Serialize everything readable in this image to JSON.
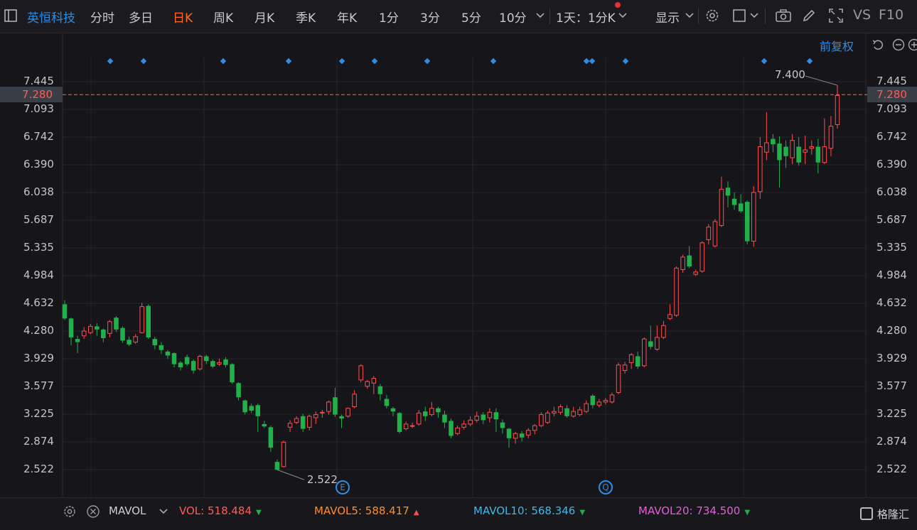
{
  "toolbar": {
    "stock_name": "英恒科技",
    "periods": [
      "分时",
      "多日",
      "日K",
      "周K",
      "月K",
      "季K",
      "年K",
      "1分",
      "3分",
      "5分",
      "10分"
    ],
    "active_period": "日K",
    "multi_period": "1天：1分K",
    "display_label": "显示",
    "vs_label": "VS",
    "f10_label": "F10"
  },
  "chart": {
    "adjust_label": "前复权",
    "current_price": "7.280",
    "max_price_label": "7.400",
    "min_price_label": "2.522",
    "event_markers": [
      "E",
      "Q"
    ],
    "colors": {
      "up": "#ff4d4f",
      "down": "#22b04b",
      "accent": "#2f8de4",
      "active": "#ff6b1a",
      "current_line": "#ff6b3d"
    },
    "y_ticks": [
      "7.445",
      "7.093",
      "6.742",
      "6.390",
      "6.038",
      "5.687",
      "5.335",
      "4.984",
      "4.632",
      "4.280",
      "3.929",
      "3.577",
      "3.225",
      "2.874",
      "2.522"
    ]
  },
  "chart_data": {
    "type": "candlestick",
    "ylim": [
      2.3,
      7.6
    ],
    "candles": [
      [
        4.62,
        4.44,
        4.67,
        4.42
      ],
      [
        4.44,
        4.2,
        4.45,
        4.1
      ],
      [
        4.18,
        4.14,
        4.22,
        4.0
      ],
      [
        4.22,
        4.28,
        4.33,
        4.18
      ],
      [
        4.26,
        4.34,
        4.37,
        4.24
      ],
      [
        4.34,
        4.3,
        4.38,
        4.22
      ],
      [
        4.3,
        4.19,
        4.31,
        4.14
      ],
      [
        4.25,
        4.4,
        4.42,
        4.2
      ],
      [
        4.45,
        4.3,
        4.47,
        4.27
      ],
      [
        4.32,
        4.16,
        4.34,
        4.13
      ],
      [
        4.17,
        4.11,
        4.21,
        4.09
      ],
      [
        4.14,
        4.21,
        4.24,
        4.12
      ],
      [
        4.26,
        4.59,
        4.64,
        4.25
      ],
      [
        4.6,
        4.2,
        4.62,
        4.18
      ],
      [
        4.18,
        4.1,
        4.21,
        4.05
      ],
      [
        4.1,
        4.04,
        4.14,
        3.99
      ],
      [
        4.02,
        3.97,
        4.04,
        3.93
      ],
      [
        4.0,
        3.86,
        4.01,
        3.82
      ],
      [
        3.88,
        3.82,
        3.9,
        3.78
      ],
      [
        3.95,
        3.86,
        3.98,
        3.84
      ],
      [
        3.9,
        3.78,
        3.92,
        3.74
      ],
      [
        3.8,
        3.96,
        3.98,
        3.78
      ],
      [
        3.96,
        3.9,
        3.98,
        3.86
      ],
      [
        3.9,
        3.83,
        3.92,
        3.81
      ],
      [
        3.86,
        3.88,
        3.93,
        3.84
      ],
      [
        3.92,
        3.85,
        3.95,
        3.82
      ],
      [
        3.86,
        3.63,
        3.87,
        3.61
      ],
      [
        3.62,
        3.44,
        3.63,
        3.4
      ],
      [
        3.4,
        3.25,
        3.41,
        3.22
      ],
      [
        3.33,
        3.27,
        3.36,
        3.24
      ],
      [
        3.34,
        3.2,
        3.36,
        3.0
      ],
      [
        3.1,
        3.07,
        3.14,
        3.05
      ],
      [
        3.06,
        2.8,
        3.08,
        2.75
      ],
      [
        2.62,
        2.52,
        2.65,
        2.52
      ],
      [
        2.56,
        2.87,
        2.89,
        2.55
      ],
      [
        3.06,
        3.11,
        3.15,
        3.0
      ],
      [
        3.12,
        3.17,
        3.2,
        3.1
      ],
      [
        3.2,
        3.04,
        3.23,
        3.0
      ],
      [
        3.06,
        3.2,
        3.22,
        3.02
      ],
      [
        3.18,
        3.22,
        3.26,
        3.1
      ],
      [
        3.24,
        3.25,
        3.28,
        3.18
      ],
      [
        3.26,
        3.38,
        3.4,
        3.22
      ],
      [
        3.44,
        3.22,
        3.56,
        3.19
      ],
      [
        3.2,
        3.17,
        3.22,
        3.05
      ],
      [
        3.2,
        3.3,
        3.31,
        3.18
      ],
      [
        3.32,
        3.48,
        3.53,
        3.3
      ],
      [
        3.66,
        3.84,
        3.86,
        3.63
      ],
      [
        3.58,
        3.64,
        3.66,
        3.55
      ],
      [
        3.62,
        3.68,
        3.71,
        3.48
      ],
      [
        3.58,
        3.48,
        3.61,
        3.4
      ],
      [
        3.42,
        3.33,
        3.47,
        3.3
      ],
      [
        3.3,
        3.26,
        3.32,
        3.2
      ],
      [
        3.24,
        3.0,
        3.25,
        2.98
      ],
      [
        3.04,
        3.1,
        3.13,
        3.02
      ],
      [
        3.08,
        3.08,
        3.12,
        3.05
      ],
      [
        3.1,
        3.24,
        3.28,
        3.08
      ],
      [
        3.26,
        3.2,
        3.32,
        3.14
      ],
      [
        3.22,
        3.3,
        3.38,
        3.2
      ],
      [
        3.3,
        3.25,
        3.32,
        3.18
      ],
      [
        3.22,
        3.12,
        3.27,
        3.05
      ],
      [
        3.14,
        2.95,
        3.17,
        2.92
      ],
      [
        2.98,
        3.05,
        3.08,
        2.96
      ],
      [
        3.06,
        3.1,
        3.15,
        3.03
      ],
      [
        3.1,
        3.15,
        3.2,
        3.07
      ],
      [
        3.15,
        3.2,
        3.26,
        3.12
      ],
      [
        3.22,
        3.15,
        3.25,
        3.1
      ],
      [
        3.18,
        3.25,
        3.3,
        3.12
      ],
      [
        3.25,
        3.16,
        3.3,
        3.0
      ],
      [
        3.12,
        3.05,
        3.16,
        2.98
      ],
      [
        3.04,
        2.92,
        3.05,
        2.8
      ],
      [
        2.92,
        2.98,
        3.0,
        2.85
      ],
      [
        2.98,
        2.93,
        3.01,
        2.88
      ],
      [
        2.96,
        3.02,
        3.05,
        2.92
      ],
      [
        3.02,
        3.08,
        3.1,
        2.97
      ],
      [
        3.08,
        3.22,
        3.25,
        3.06
      ],
      [
        3.12,
        3.24,
        3.27,
        3.1
      ],
      [
        3.24,
        3.26,
        3.32,
        3.2
      ],
      [
        3.25,
        3.32,
        3.35,
        3.22
      ],
      [
        3.3,
        3.2,
        3.34,
        3.18
      ],
      [
        3.2,
        3.26,
        3.32,
        3.18
      ],
      [
        3.22,
        3.28,
        3.32,
        3.2
      ],
      [
        3.26,
        3.36,
        3.4,
        3.24
      ],
      [
        3.46,
        3.34,
        3.48,
        3.3
      ],
      [
        3.34,
        3.38,
        3.42,
        3.31
      ],
      [
        3.38,
        3.4,
        3.43,
        3.35
      ],
      [
        3.38,
        3.47,
        3.5,
        3.36
      ],
      [
        3.5,
        3.85,
        3.88,
        3.48
      ],
      [
        3.78,
        3.85,
        3.89,
        3.74
      ],
      [
        3.88,
        3.98,
        4.0,
        3.8
      ],
      [
        3.96,
        3.83,
        4.02,
        3.8
      ],
      [
        3.84,
        4.18,
        4.2,
        3.82
      ],
      [
        4.15,
        4.08,
        4.35,
        4.05
      ],
      [
        4.05,
        4.2,
        4.35,
        4.03
      ],
      [
        4.2,
        4.35,
        4.41,
        4.18
      ],
      [
        4.44,
        4.49,
        4.62,
        4.42
      ],
      [
        4.48,
        5.08,
        5.1,
        4.46
      ],
      [
        5.06,
        5.22,
        5.25,
        5.02
      ],
      [
        5.24,
        5.1,
        5.36,
        5.08
      ],
      [
        5.0,
        5.03,
        5.06,
        4.98
      ],
      [
        5.04,
        5.4,
        5.42,
        5.02
      ],
      [
        5.44,
        5.6,
        5.64,
        5.38
      ],
      [
        5.36,
        5.67,
        5.7,
        5.34
      ],
      [
        5.62,
        6.08,
        6.24,
        5.6
      ],
      [
        6.1,
        6.0,
        6.18,
        5.85
      ],
      [
        5.96,
        5.88,
        6.04,
        5.82
      ],
      [
        5.9,
        5.8,
        6.02,
        5.78
      ],
      [
        5.92,
        5.42,
        5.94,
        5.38
      ],
      [
        5.42,
        6.04,
        6.12,
        5.35
      ],
      [
        6.05,
        6.62,
        6.74,
        5.96
      ],
      [
        6.55,
        6.67,
        7.06,
        6.45
      ],
      [
        6.72,
        6.65,
        6.78,
        6.55
      ],
      [
        6.66,
        6.45,
        6.75,
        6.1
      ],
      [
        6.62,
        6.5,
        6.7,
        6.35
      ],
      [
        6.48,
        6.7,
        6.78,
        6.4
      ],
      [
        6.62,
        6.42,
        6.74,
        6.38
      ],
      [
        6.55,
        6.58,
        6.76,
        6.4
      ],
      [
        6.6,
        6.62,
        6.7,
        6.52
      ],
      [
        6.62,
        6.42,
        6.72,
        6.28
      ],
      [
        6.42,
        6.62,
        6.98,
        6.4
      ],
      [
        6.6,
        6.88,
        7.01,
        6.5
      ],
      [
        6.9,
        7.27,
        7.4,
        6.85
      ]
    ]
  },
  "indicator": {
    "name": "MAVOL",
    "vol": "VOL: 518.484",
    "mavol5": "MAVOL5: 588.417",
    "mavol10": "MAVOL10: 568.346",
    "mavol20": "MAVOL20: 734.500"
  },
  "brand": "格隆汇"
}
